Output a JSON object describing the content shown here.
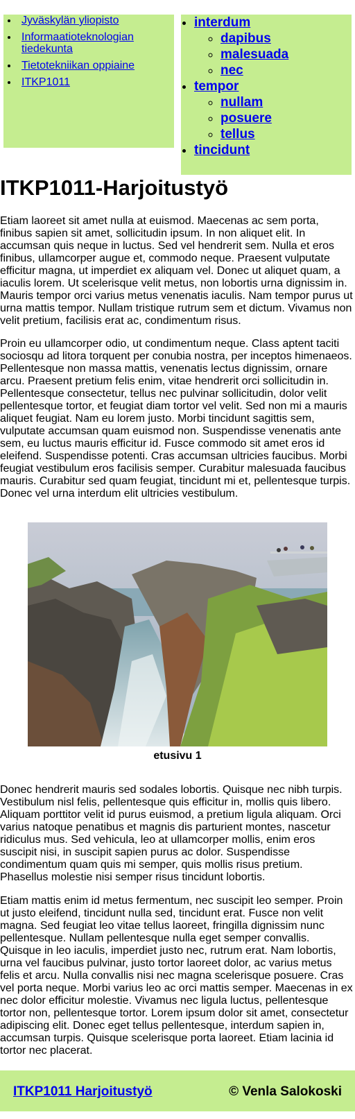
{
  "nav_left": {
    "items": [
      {
        "label": "Jyväskylän yliopisto"
      },
      {
        "label": "Informaatioteknologian tiedekunta"
      },
      {
        "label": "Tietotekniikan oppiaine"
      },
      {
        "label": "ITKP1011"
      }
    ]
  },
  "nav_right": {
    "groups": [
      {
        "label": "interdum",
        "children": [
          "dapibus",
          "malesuada",
          "nec"
        ]
      },
      {
        "label": "tempor",
        "children": [
          "nullam",
          "posuere",
          "tellus"
        ]
      },
      {
        "label": "tincidunt",
        "children": []
      }
    ]
  },
  "main": {
    "title": "ITKP1011-Harjoitustyö",
    "paragraphs": [
      "Etiam laoreet sit amet nulla at euismod. Maecenas ac sem porta, finibus sapien sit amet, sollicitudin ipsum. In non aliquet elit. In accumsan quis neque in luctus. Sed vel hendrerit sem. Nulla et eros finibus, ullamcorper augue et, commodo neque. Praesent vulputate efficitur magna, ut imperdiet ex aliquam vel. Donec ut aliquet quam, a iaculis lorem. Ut scelerisque velit metus, non lobortis urna dignissim in. Mauris tempor orci varius metus venenatis iaculis. Nam tempor purus ut urna mattis tempor. Nullam tristique rutrum sem et dictum. Vivamus non velit pretium, facilisis erat ac, condimentum risus.",
      "Proin eu ullamcorper odio, ut condimentum neque. Class aptent taciti sociosqu ad litora torquent per conubia nostra, per inceptos himenaeos. Pellentesque non massa mattis, venenatis lectus dignissim, ornare arcu. Praesent pretium felis enim, vitae hendrerit orci sollicitudin in. Pellentesque consectetur, tellus nec pulvinar sollicitudin, dolor velit pellentesque tortor, et feugiat diam tortor vel velit. Sed non mi a mauris aliquet feugiat. Nam eu lorem justo. Morbi tincidunt sagittis sem, vulputate accumsan quam euismod non. Suspendisse venenatis ante sem, eu luctus mauris efficitur id. Fusce commodo sit amet eros id eleifend. Suspendisse potenti. Cras accumsan ultricies faucibus. Morbi feugiat vestibulum eros facilisis semper. Curabitur malesuada faucibus mauris. Curabitur sed quam feugiat, tincidunt mi et, pellentesque turpis. Donec vel urna interdum elit ultricies vestibulum.",
      "Donec hendrerit mauris sed sodales lobortis. Quisque nec nibh turpis. Vestibulum nisl felis, pellentesque quis efficitur in, mollis quis libero. Aliquam porttitor velit id purus euismod, a pretium ligula aliquam. Orci varius natoque penatibus et magnis dis parturient montes, nascetur ridiculus mus. Sed vehicula, leo at ullamcorper mollis, enim eros suscipit nisi, in suscipit sapien purus ac dolor. Suspendisse condimentum quam quis mi semper, quis mollis risus pretium. Phasellus molestie nisi semper risus tincidunt lobortis.",
      "Etiam mattis enim id metus fermentum, nec suscipit leo semper. Proin ut justo eleifend, tincidunt nulla sed, tincidunt erat. Fusce non velit magna. Sed feugiat leo vitae tellus laoreet, fringilla dignissim nunc pellentesque. Nullam pellentesque nulla eget semper convallis. Quisque in leo iaculis, imperdiet justo nec, rutrum erat. Nam lobortis, urna vel faucibus pulvinar, justo tortor laoreet dolor, ac varius metus felis et arcu. Nulla convallis nisi nec magna scelerisque posuere. Cras vel porta neque. Morbi varius leo ac orci mattis semper. Maecenas in ex nec dolor efficitur molestie. Vivamus nec ligula luctus, pellentesque tortor non, pellentesque tortor. Lorem ipsum dolor sit amet, consectetur adipiscing elit. Donec eget tellus pellentesque, interdum sapien in, accumsan turpis. Quisque scelerisque porta laoreet. Etiam lacinia id tortor nec placerat."
    ],
    "figure": {
      "caption": "etusivu 1"
    }
  },
  "footer": {
    "link": "ITKP1011 Harjoitustyö",
    "copyright": "©  Venla Salokoski"
  },
  "colors": {
    "nav_bg": "#c5ed90",
    "link": "#0000ee"
  }
}
